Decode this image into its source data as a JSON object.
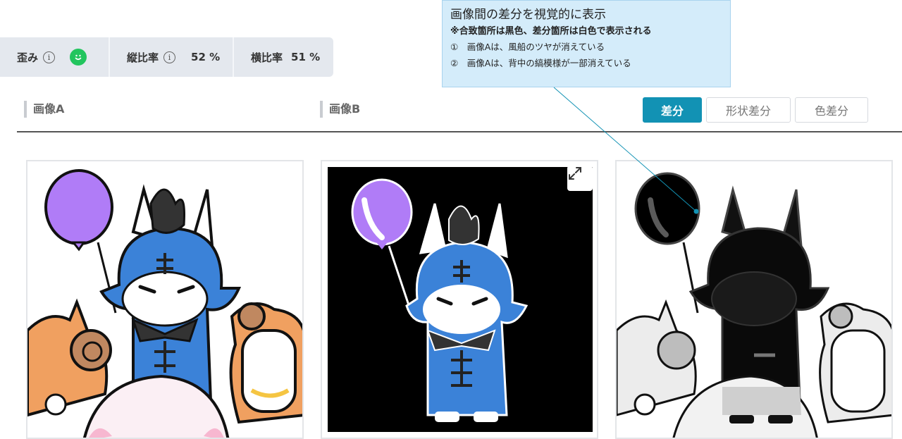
{
  "metrics": {
    "distortion_label": "歪み",
    "aspect_v_label": "縦比率",
    "aspect_v_value": "52 %",
    "aspect_h_label": "横比率",
    "aspect_h_value": "51 %"
  },
  "callout": {
    "title": "画像間の差分を視覚的に表示",
    "note": "※合致箇所は黒色、差分箇所は白色で表示される",
    "items": [
      "①　画像Aは、風船のツヤが消えている",
      "②　画像Aは、背中の縞模様が一部消えている"
    ]
  },
  "columns": {
    "a_title": "画像A",
    "b_title": "画像B"
  },
  "tabs": {
    "diff": "差分",
    "shape_diff": "形状差分",
    "color_diff": "色差分"
  },
  "colors": {
    "accent": "#1292b4",
    "balloon": "#b07cf7",
    "dragon_blue": "#3b82d8",
    "orange": "#f0a060"
  }
}
